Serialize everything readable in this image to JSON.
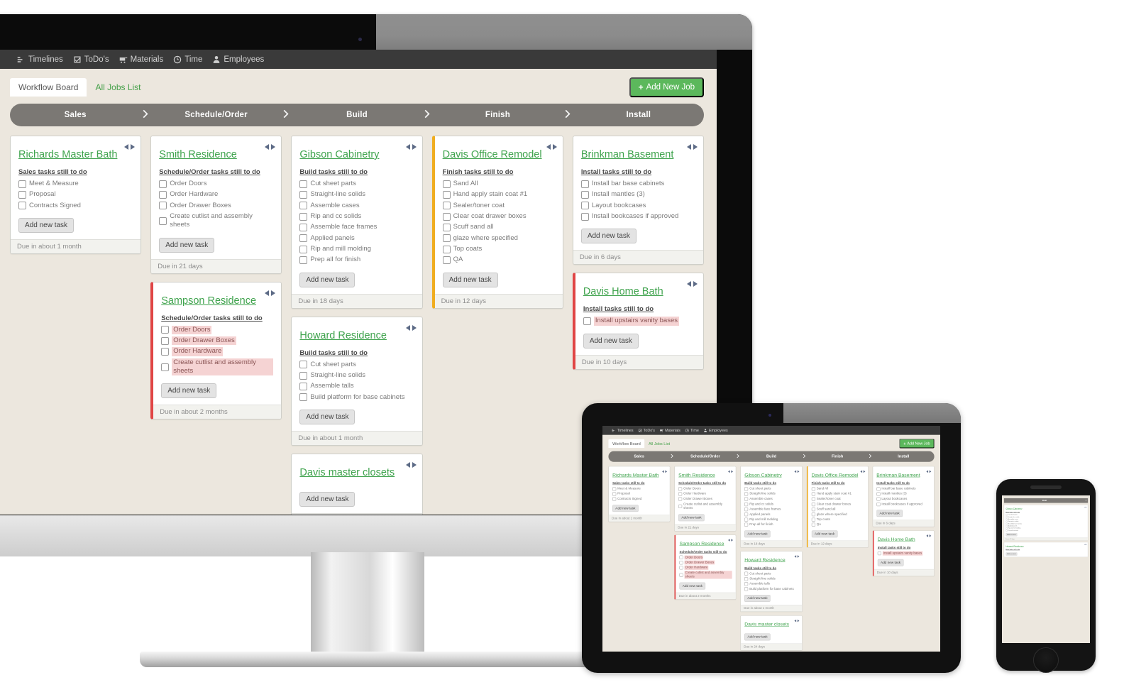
{
  "nav": {
    "items": [
      {
        "label": "Timelines",
        "icon": "timeline-icon"
      },
      {
        "label": "ToDo's",
        "icon": "checkbox-icon"
      },
      {
        "label": "Materials",
        "icon": "cart-icon"
      },
      {
        "label": "Time",
        "icon": "clock-icon"
      },
      {
        "label": "Employees",
        "icon": "person-icon"
      }
    ]
  },
  "tabs": {
    "workflow_board": "Workflow Board",
    "all_jobs_list": "All Jobs List",
    "add_new_job": "Add New Job",
    "plus": "+"
  },
  "stages": [
    {
      "label": "Sales"
    },
    {
      "label": "Schedule/Order"
    },
    {
      "label": "Build"
    },
    {
      "label": "Finish"
    },
    {
      "label": "Install"
    }
  ],
  "add_task_label": "Add new task",
  "colors": {
    "accent_green": "#3fa34d",
    "button_green": "#5cb85c",
    "overdue_red": "#e04545",
    "warning_amber": "#f0ad20",
    "stage_bar": "#7b7874",
    "page_bg": "#ece7de",
    "topnav": "#3a3a3a"
  },
  "columns": [
    {
      "stage": "Sales",
      "cards": [
        {
          "title": "Richards Master Bath",
          "tasks_head": "Sales tasks still to do",
          "status": "normal",
          "tasks": [
            {
              "label": "Meet & Measure",
              "late": false
            },
            {
              "label": "Proposal",
              "late": false
            },
            {
              "label": "Contracts Signed",
              "late": false
            }
          ],
          "due": "Due in about 1 month"
        }
      ]
    },
    {
      "stage": "Schedule/Order",
      "cards": [
        {
          "title": "Smith Residence",
          "tasks_head": "Schedule/Order tasks still to do",
          "status": "normal",
          "tasks": [
            {
              "label": "Order Doors",
              "late": false
            },
            {
              "label": "Order Hardware",
              "late": false
            },
            {
              "label": "Order Drawer Boxes",
              "late": false
            },
            {
              "label": "Create cutlist and assembly sheets",
              "late": false
            }
          ],
          "due": "Due in 21 days"
        },
        {
          "title": "Sampson Residence",
          "tasks_head": "Schedule/Order tasks still to do",
          "status": "red",
          "tasks": [
            {
              "label": "Order Doors",
              "late": true
            },
            {
              "label": "Order Drawer Boxes",
              "late": true
            },
            {
              "label": "Order Hardware",
              "late": true
            },
            {
              "label": "Create cutlist and assembly sheets",
              "late": true
            }
          ],
          "due": "Due in about 2 months"
        }
      ]
    },
    {
      "stage": "Build",
      "cards": [
        {
          "title": "Gibson Cabinetry",
          "tasks_head": "Build tasks still to do",
          "status": "normal",
          "tasks": [
            {
              "label": "Cut sheet parts",
              "late": false
            },
            {
              "label": "Straight-line solids",
              "late": false
            },
            {
              "label": "Assemble cases",
              "late": false
            },
            {
              "label": "Rip and cc solids",
              "late": false
            },
            {
              "label": "Assemble face frames",
              "late": false
            },
            {
              "label": "Applied panels",
              "late": false
            },
            {
              "label": "Rip and mill molding",
              "late": false
            },
            {
              "label": "Prep all for finish",
              "late": false
            }
          ],
          "due": "Due in 18 days"
        },
        {
          "title": "Howard Residence",
          "tasks_head": "Build tasks still to do",
          "status": "normal",
          "tasks": [
            {
              "label": "Cut sheet parts",
              "late": false
            },
            {
              "label": "Straight-line solids",
              "late": false
            },
            {
              "label": "Assemble talls",
              "late": false
            },
            {
              "label": "Build platform for base cabinets",
              "late": false
            }
          ],
          "due": "Due in about 1 month"
        },
        {
          "title": "Davis master closets",
          "tasks_head": "",
          "status": "normal",
          "tasks": [],
          "due": "Due in 24 days"
        }
      ]
    },
    {
      "stage": "Finish",
      "cards": [
        {
          "title": "Davis Office Remodel",
          "tasks_head": "Finish tasks still to do",
          "status": "amber",
          "tasks": [
            {
              "label": "Sand All",
              "late": false
            },
            {
              "label": "Hand apply stain coat #1",
              "late": false
            },
            {
              "label": "Sealer/toner coat",
              "late": false
            },
            {
              "label": "Clear coat drawer boxes",
              "late": false
            },
            {
              "label": "Scuff sand all",
              "late": false
            },
            {
              "label": "glaze where specified",
              "late": false
            },
            {
              "label": "Top coats",
              "late": false
            },
            {
              "label": "QA",
              "late": false
            }
          ],
          "due": "Due in 12 days"
        }
      ]
    },
    {
      "stage": "Install",
      "cards": [
        {
          "title": "Brinkman Basement",
          "tasks_head": "Install tasks still to do",
          "status": "normal",
          "tasks": [
            {
              "label": "Install bar base cabinets",
              "late": false
            },
            {
              "label": "Install mantles (3)",
              "late": false
            },
            {
              "label": "Layout bookcases",
              "late": false
            },
            {
              "label": "Install bookcases if approved",
              "late": false
            }
          ],
          "due": "Due in 6 days"
        },
        {
          "title": "Davis Home Bath",
          "tasks_head": "Install tasks still to do",
          "status": "red",
          "tasks": [
            {
              "label": "Install upstairs vanity bases",
              "late": true
            }
          ],
          "due": "Due in 10 days"
        }
      ]
    }
  ],
  "phone_view": {
    "stage": "Build",
    "cards": [
      {
        "title": "Gibson Cabinetry",
        "tasks_head": "Build tasks still to do",
        "status": "normal",
        "tasks": [
          {
            "label": "Cut sheet parts",
            "late": false
          },
          {
            "label": "Straight-line solids",
            "late": false
          },
          {
            "label": "Assemble cases",
            "late": false
          },
          {
            "label": "Rip and cc solids",
            "late": false
          },
          {
            "label": "Assemble face frames",
            "late": false
          },
          {
            "label": "Applied panels",
            "late": false
          },
          {
            "label": "Rip and mill molding",
            "late": false
          },
          {
            "label": "Prep all for finish",
            "late": false
          }
        ],
        "due": "Due in 18 days"
      },
      {
        "title": "Howard Residence",
        "tasks_head": "Build tasks still to do",
        "status": "normal",
        "tasks": [],
        "due": ""
      }
    ]
  }
}
